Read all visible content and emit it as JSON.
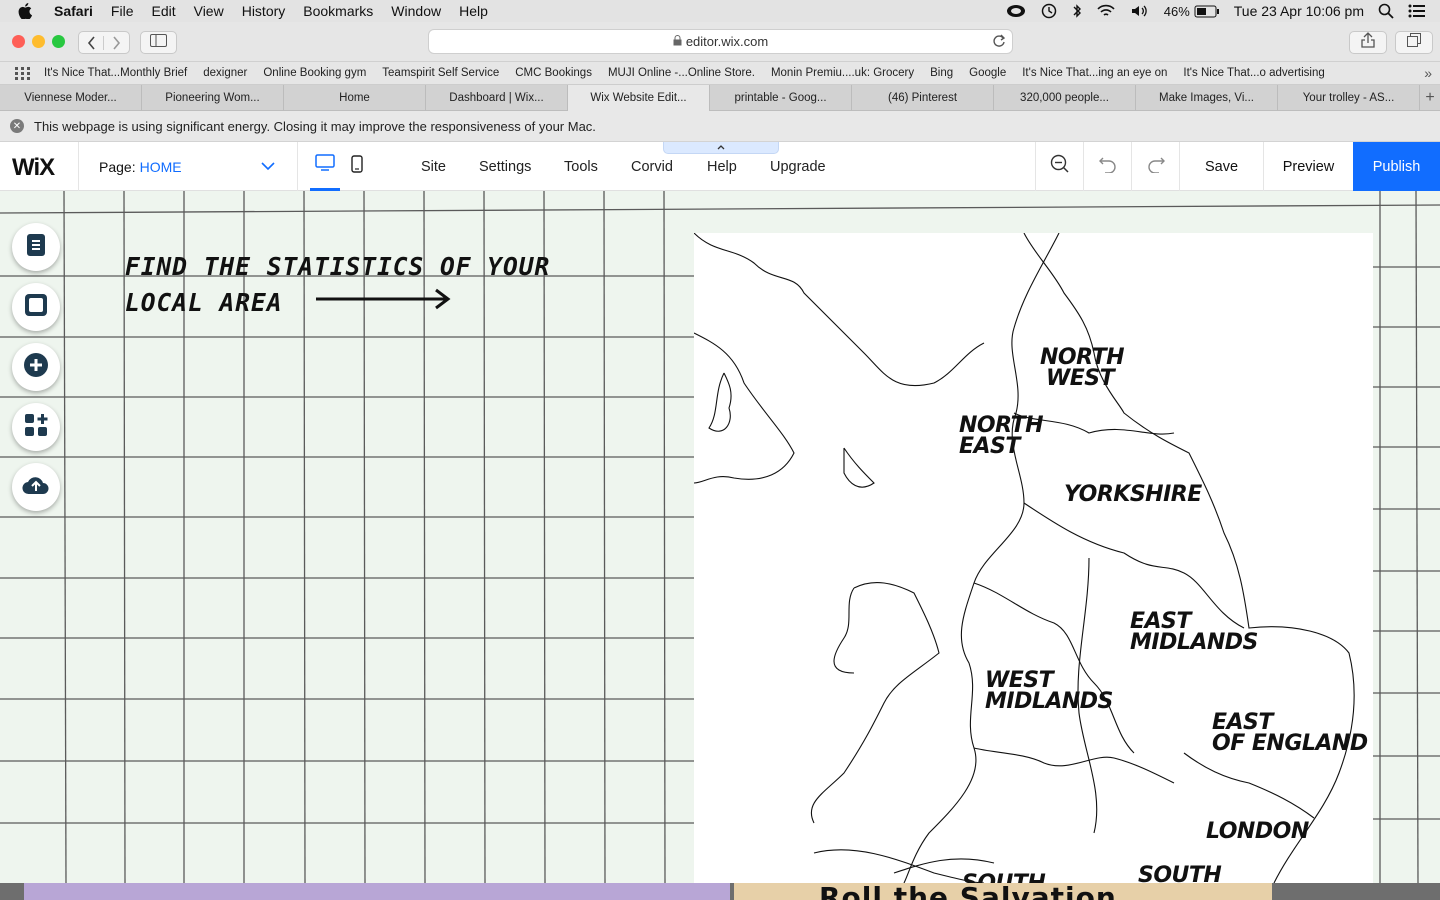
{
  "menubar": {
    "app": "Safari",
    "items": [
      "File",
      "Edit",
      "View",
      "History",
      "Bookmarks",
      "Window",
      "Help"
    ],
    "battery": "46%",
    "datetime": "Tue 23 Apr  10:06 pm"
  },
  "browser": {
    "url": "editor.wix.com",
    "bookmarks": [
      "It's Nice That...Monthly Brief",
      "dexigner",
      "Online Booking gym",
      "Teamspirit Self Service",
      "CMC Bookings",
      "MUJI Online -...Online Store.",
      "Monin Premiu....uk: Grocery",
      "Bing",
      "Google",
      "It's Nice That...ing an eye on",
      "It's Nice That...o advertising"
    ],
    "tabs": [
      "Viennese Moder...",
      "Pioneering Wom...",
      "Home",
      "Dashboard | Wix...",
      "Wix Website Edit...",
      "printable - Goog...",
      "(46) Pinterest",
      "320,000 people...",
      "Make Images, Vi...",
      "Your trolley - AS..."
    ],
    "active_tab": 4,
    "energy_warning": "This webpage is using significant energy. Closing it may improve the responsiveness of your Mac."
  },
  "wix": {
    "logo": "WiX",
    "page_label": "Page:",
    "page_value": "HOME",
    "menu": [
      "Site",
      "Settings",
      "Tools",
      "Corvid",
      "Help",
      "Upgrade"
    ],
    "save": "Save",
    "preview": "Preview",
    "publish": "Publish"
  },
  "canvas": {
    "headline_line1": "FIND THE STATISTICS OF YOUR",
    "headline_line2": "LOCAL AREA",
    "regions": {
      "north_west_1": "NORTH",
      "north_west_2": "WEST",
      "north_east_1": "NORTH",
      "north_east_2": "EAST",
      "yorkshire": "YORKSHIRE",
      "east_midlands_1": "EAST",
      "east_midlands_2": "MIDLANDS",
      "west_midlands_1": "WEST",
      "west_midlands_2": "MIDLANDS",
      "east_of_england_1": "EAST",
      "east_of_england_2": "OF ENGLAND",
      "london": "LONDON",
      "south": "SOUTH",
      "south_2": "SOUTH"
    },
    "below_fold_text": "Roll the Salvation"
  },
  "colors": {
    "publish": "#116dff",
    "canvas_bg": "#eef5ee",
    "grid_line": "#555555"
  }
}
